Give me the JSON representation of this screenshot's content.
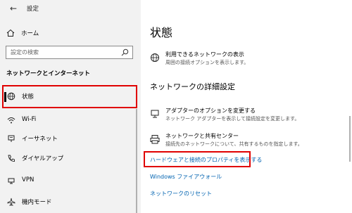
{
  "window": {
    "title": "設定",
    "back_glyph": "←",
    "min_glyph": "—",
    "close_glyph": "✕"
  },
  "sidebar": {
    "home_label": "ホーム",
    "search_placeholder": "設定の検索",
    "section_title": "ネットワークとインターネット",
    "items": [
      {
        "label": "状態",
        "icon": "globe-icon",
        "active": true
      },
      {
        "label": "Wi-Fi",
        "icon": "wifi-icon"
      },
      {
        "label": "イーサネット",
        "icon": "ethernet-icon"
      },
      {
        "label": "ダイヤルアップ",
        "icon": "phone-icon"
      },
      {
        "label": "VPN",
        "icon": "vpn-icon"
      },
      {
        "label": "機内モード",
        "icon": "airplane-icon"
      }
    ]
  },
  "main": {
    "title": "状態",
    "available_networks": {
      "title": "利用できるネットワークの表示",
      "desc": "周囲の接続オプションを表示します。"
    },
    "advanced_heading": "ネットワークの詳細設定",
    "adapter_options": {
      "title": "アダプターのオプションを変更する",
      "desc": "ネットワーク アダプターを表示して接続設定を変更します。"
    },
    "sharing_center": {
      "title": "ネットワークと共有センター",
      "desc": "接続先のネットワークについて、共有するものを指定します。"
    },
    "links": {
      "hardware_props": "ハードウェアと接続のプロパティを表示する",
      "firewall": "Windows ファイアウォール",
      "reset": "ネットワークのリセット"
    }
  },
  "colors": {
    "accent": "#0063b1",
    "highlight": "#e00000",
    "sidebar_bg": "#f2f2f2"
  }
}
